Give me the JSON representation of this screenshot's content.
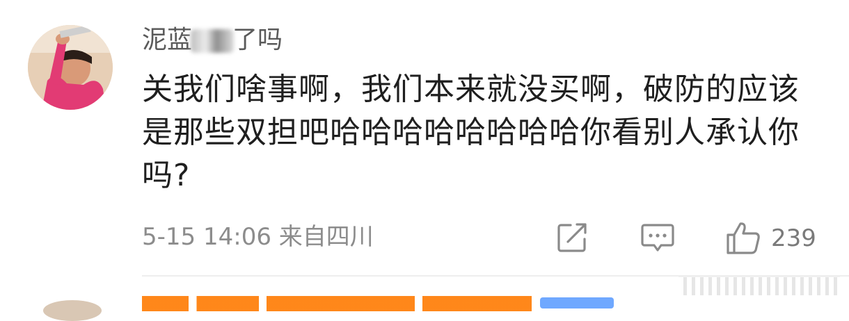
{
  "comment": {
    "username_before": "泥蓝",
    "username_after": "了吗",
    "text": "关我们啥事啊，我们本来就没买啊，破防的应该是那些双担吧哈哈哈哈哈哈哈哈你看别人承认你吗?",
    "timestamp": "5-15 14:06",
    "location": "来自四川",
    "like_count": "239"
  },
  "icons": {
    "repost": "repost-icon",
    "reply": "comment-icon",
    "like": "thumbs-up-icon"
  },
  "colors": {
    "username": "#5a5a5a",
    "text": "#1f1f1f",
    "meta": "#8c8c8c",
    "icon": "#8a8a8a",
    "next_name": "#ff7a00"
  }
}
